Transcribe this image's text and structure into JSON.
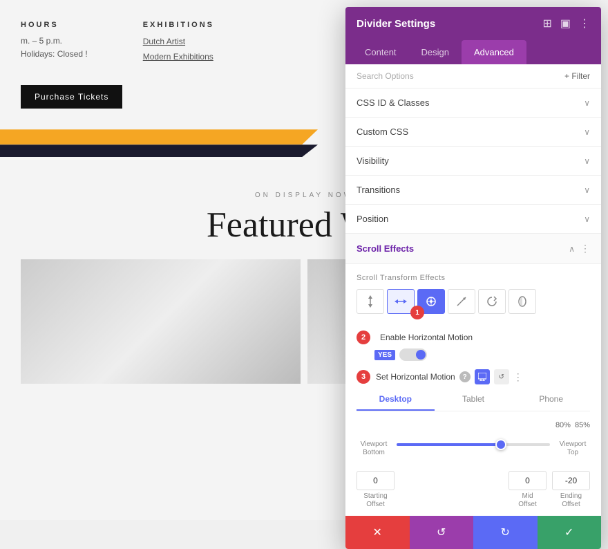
{
  "background": {
    "hours_title": "HOURS",
    "hours_line1": "m. – 5 p.m.",
    "hours_line2": "Holidays: Closed !",
    "exhibitions_title": "EXHIBITIONS",
    "dutch_artist": "Dutch Artist",
    "modern_exhibitions": "Modern Exhibitions",
    "ticket_btn": "Purchase Tickets",
    "on_display": "ON DISPLAY NOW",
    "featured_title": "Featured Wor"
  },
  "panel": {
    "title": "Divider Settings",
    "tabs": [
      "Content",
      "Design",
      "Advanced"
    ],
    "active_tab": "Advanced",
    "search_placeholder": "Search Options",
    "filter_label": "+ Filter",
    "sections": [
      {
        "label": "CSS ID & Classes"
      },
      {
        "label": "Custom CSS"
      },
      {
        "label": "Visibility"
      },
      {
        "label": "Transitions"
      },
      {
        "label": "Position"
      }
    ],
    "scroll_effects": {
      "label": "Scroll Effects",
      "transform_title": "Scroll Transform Effects",
      "icons": [
        "↕",
        "↔",
        "⊞",
        "↗",
        "↺",
        "◈"
      ],
      "active_icon_index": 2,
      "badge1_label": "1",
      "badge2_label": "2",
      "badge3_label": "3",
      "enable_label": "Enable Horizontal Motion",
      "toggle_yes": "YES",
      "set_label": "Set Horizontal Motion",
      "device_tabs": [
        "Desktop",
        "Tablet",
        "Phone"
      ],
      "active_device": "Desktop",
      "percent1": "80%",
      "percent2": "85%",
      "viewport_bottom": "Viewport\nBottom",
      "viewport_top": "Viewport\nTop",
      "starting_offset_val": "0",
      "starting_offset_label": "Starting\nOffset",
      "mid_offset_val": "0",
      "mid_offset_label": "Mid\nOffset",
      "ending_offset_val": "-20",
      "ending_offset_label": "Ending\nOffset"
    },
    "actions": {
      "cancel": "✕",
      "reset": "↺",
      "redo": "↻",
      "confirm": "✓"
    }
  }
}
